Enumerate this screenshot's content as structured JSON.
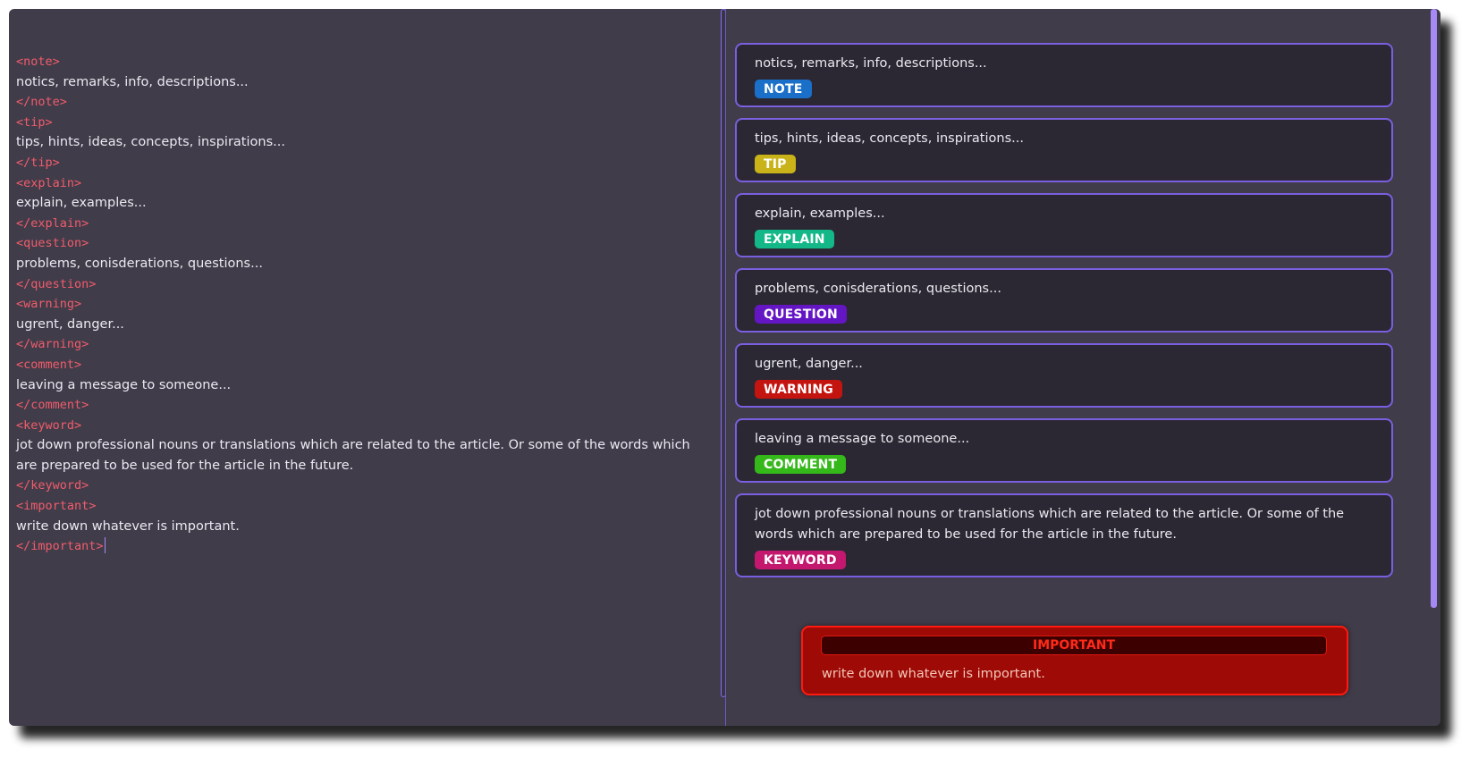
{
  "editor": {
    "lines": [
      {
        "kind": "tag",
        "text": "<note>"
      },
      {
        "kind": "text",
        "text": "notics, remarks, info, descriptions..."
      },
      {
        "kind": "tag",
        "text": "</note>"
      },
      {
        "kind": "tag",
        "text": "<tip>"
      },
      {
        "kind": "text",
        "text": "tips, hints, ideas, concepts, inspirations..."
      },
      {
        "kind": "tag",
        "text": "</tip>"
      },
      {
        "kind": "tag",
        "text": "<explain>"
      },
      {
        "kind": "text",
        "text": "explain, examples..."
      },
      {
        "kind": "tag",
        "text": "</explain>"
      },
      {
        "kind": "tag",
        "text": "<question>"
      },
      {
        "kind": "text",
        "text": "problems, conisderations, questions..."
      },
      {
        "kind": "tag",
        "text": "</question>"
      },
      {
        "kind": "tag",
        "text": "<warning>"
      },
      {
        "kind": "text",
        "text": "ugrent, danger..."
      },
      {
        "kind": "tag",
        "text": "</warning>"
      },
      {
        "kind": "tag",
        "text": "<comment>"
      },
      {
        "kind": "text",
        "text": "leaving a message to someone..."
      },
      {
        "kind": "tag",
        "text": "</comment>"
      },
      {
        "kind": "tag",
        "text": "<keyword>"
      },
      {
        "kind": "text",
        "text": " jot down professional nouns or translations which are related to the article. Or some of the words which are prepared to be used for the article in the future."
      },
      {
        "kind": "tag",
        "text": "</keyword>"
      },
      {
        "kind": "tag",
        "text": "<important>"
      },
      {
        "kind": "text",
        "text": "write down whatever is important."
      },
      {
        "kind": "tag",
        "text": "</important>"
      }
    ]
  },
  "preview": {
    "cards": [
      {
        "text": "notics, remarks, info, descriptions...",
        "badge": "NOTE",
        "color": "#1a6fc9"
      },
      {
        "text": "tips, hints, ideas, concepts, inspirations...",
        "badge": "TIP",
        "color": "#c9b318"
      },
      {
        "text": "explain, examples...",
        "badge": "EXPLAIN",
        "color": "#14b888"
      },
      {
        "text": "problems, conisderations, questions...",
        "badge": "QUESTION",
        "color": "#6415c4"
      },
      {
        "text": "ugrent, danger...",
        "badge": "WARNING",
        "color": "#c4140f"
      },
      {
        "text": "leaving a message to someone...",
        "badge": "COMMENT",
        "color": "#34b81a"
      },
      {
        "text": "jot down professional nouns or translations which are related to the article. Or some of the words which are prepared to be used for the article in the future.",
        "badge": "KEYWORD",
        "color": "#c4186f"
      }
    ],
    "important": {
      "title": "IMPORTANT",
      "text": "write down whatever is important."
    }
  }
}
